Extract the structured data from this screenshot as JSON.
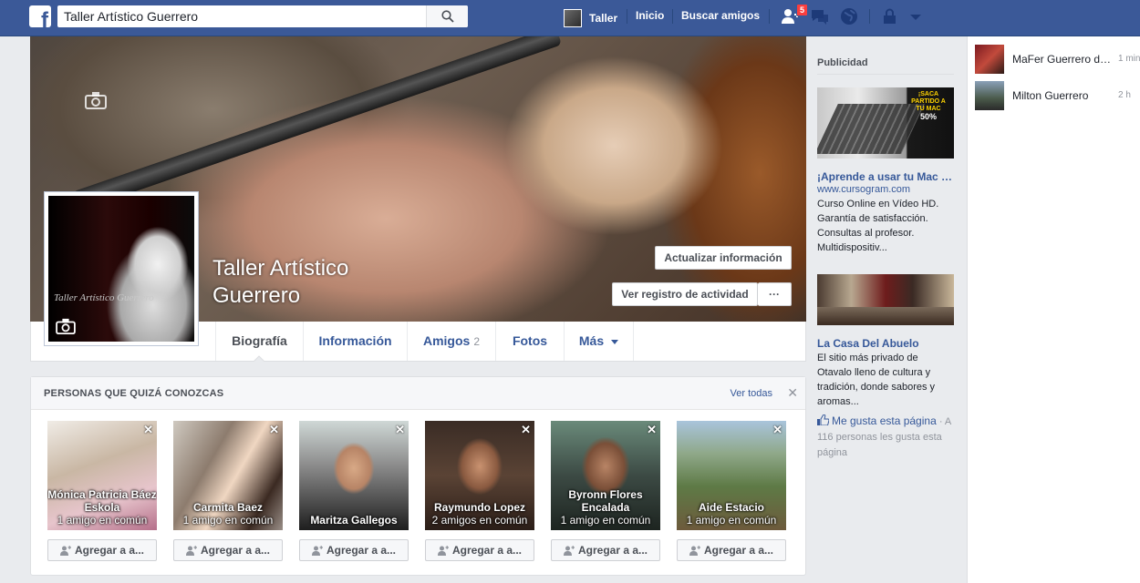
{
  "search": {
    "value": "Taller Artístico Guerrero"
  },
  "nav": {
    "user_name": "Taller",
    "home": "Inicio",
    "find_friends": "Buscar amigos",
    "friend_requests_count": "5"
  },
  "profile": {
    "name_line1": "Taller Artístico",
    "name_line2": "Guerrero",
    "update_info_label": "Actualizar información",
    "activity_log_label": "Ver registro de actividad",
    "more_label": "···",
    "picture_watermark": "Taller Artístico Guerrero"
  },
  "tabs": [
    {
      "label": "Biografía"
    },
    {
      "label": "Información"
    },
    {
      "label": "Amigos",
      "count": "2"
    },
    {
      "label": "Fotos"
    },
    {
      "label": "Más"
    }
  ],
  "pymk": {
    "title": "PERSONAS QUE QUIZÁ CONOZCAS",
    "see_all": "Ver todas",
    "add_label": "Agregar a a...",
    "people": [
      {
        "name": "Mónica Patricia Báez Eskola",
        "mutual": "1 amigo en común"
      },
      {
        "name": "Carmita Baez",
        "mutual": "1 amigo en común"
      },
      {
        "name": "Maritza Gallegos",
        "mutual": ""
      },
      {
        "name": "Raymundo Lopez",
        "mutual": "2 amigos en común"
      },
      {
        "name": "Byronn Flores Encalada",
        "mutual": "1 amigo en común"
      },
      {
        "name": "Aide Estacio",
        "mutual": "1 amigo en común"
      }
    ]
  },
  "ads": {
    "title": "Publicidad",
    "ad1": {
      "image_text": "¡SACA PARTIDO A TU MAC",
      "image_pct": "50%",
      "headline": "¡Aprende a usar tu Mac de...",
      "url": "www.cursogram.com",
      "body": "Curso Online en Vídeo HD. Garantía de satisfacción. Consultas al profesor. Multidispositiv..."
    },
    "ad2": {
      "headline": "La Casa Del Abuelo",
      "body": "El sitio más privado de Otavalo lleno de cultura y tradición, donde sabores y aromas...",
      "like_label": "Me gusta esta página",
      "like_count": "· A 116 personas les gusta esta página"
    }
  },
  "chat": [
    {
      "name": "MaFer Guerrero de...",
      "time": "1 min"
    },
    {
      "name": "Milton Guerrero",
      "time": "2 h"
    }
  ],
  "colors": {
    "brand": "#3b5998",
    "link": "#365899",
    "badge": "#fa3e3e"
  }
}
